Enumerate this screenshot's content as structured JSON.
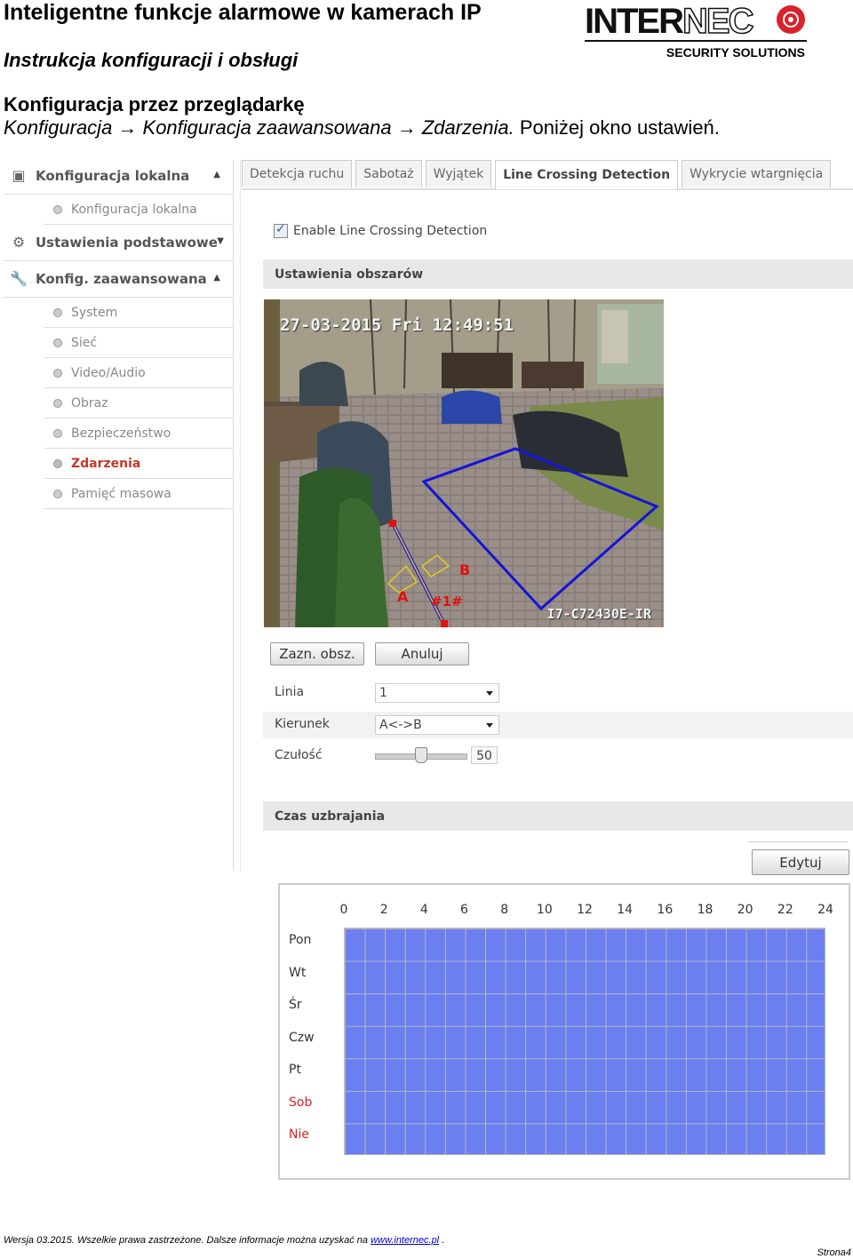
{
  "doc": {
    "title": "Inteligentne funkcje alarmowe w kamerach IP",
    "subtitle": "Instrukcja konfiguracji i obsługi",
    "section": "Konfiguracja przez przeglądarkę",
    "path_italic": "Konfiguracja → Konfiguracja zaawansowana → Zdarzenia.",
    "path_rest": " Poniżej okno ustawień."
  },
  "logo": {
    "solid": "INTER",
    "outline": "NEC",
    "sub": "SECURITY  SOLUTIONS"
  },
  "sidebar": {
    "groups": [
      {
        "label": "Konfiguracja lokalna",
        "icon": "monitor-icon",
        "items": [
          "Konfiguracja lokalna"
        ]
      },
      {
        "label": "Ustawienia podstawowe",
        "icon": "gear-icon",
        "items": []
      },
      {
        "label": "Konfig. zaawansowana",
        "icon": "wrench-icon",
        "items": [
          "System",
          "Sieć",
          "Video/Audio",
          "Obraz",
          "Bezpieczeństwo",
          "Zdarzenia",
          "Pamięć masowa"
        ]
      }
    ],
    "active_item": "Zdarzenia"
  },
  "tabs": [
    "Detekcja ruchu",
    "Sabotaż",
    "Wyjątek",
    "Line Crossing Detection",
    "Wykrycie wtargnięcia"
  ],
  "active_tab": "Line Crossing Detection",
  "enable_label": "Enable Line Crossing Detection",
  "area_settings_title": "Ustawienia obszarów",
  "camera": {
    "timestamp": "27-03-2015 Fri 12:49:51",
    "name": "I7-C72430E-IR",
    "label_a": "A",
    "label_b": "B",
    "label_line": "#1#"
  },
  "buttons": {
    "draw": "Zazn. obsz.",
    "cancel": "Anuluj",
    "edit": "Edytuj"
  },
  "form": {
    "line_label": "Linia",
    "line_value": "1",
    "direction_label": "Kierunek",
    "direction_value": "A<->B",
    "sensitivity_label": "Czułość",
    "sensitivity_value": "50"
  },
  "sensitivity_fraction": 0.5,
  "schedule": {
    "title": "Czas uzbrajania",
    "hours": [
      "0",
      "2",
      "4",
      "6",
      "8",
      "10",
      "12",
      "14",
      "16",
      "18",
      "20",
      "22",
      "24"
    ],
    "days": [
      "Pon",
      "Wt",
      "Śr",
      "Czw",
      "Pt",
      "Sob",
      "Nie"
    ],
    "grid_color": "#6b7ff0",
    "weekend_color": "#dd2222"
  },
  "footer": {
    "text": "Wersja  03.2015. Wszelkie prawa zastrzeżone. Dalsze informacje można uzyskać na ",
    "link": "www.internec.pl",
    "after": " .",
    "page": "Strona4"
  }
}
